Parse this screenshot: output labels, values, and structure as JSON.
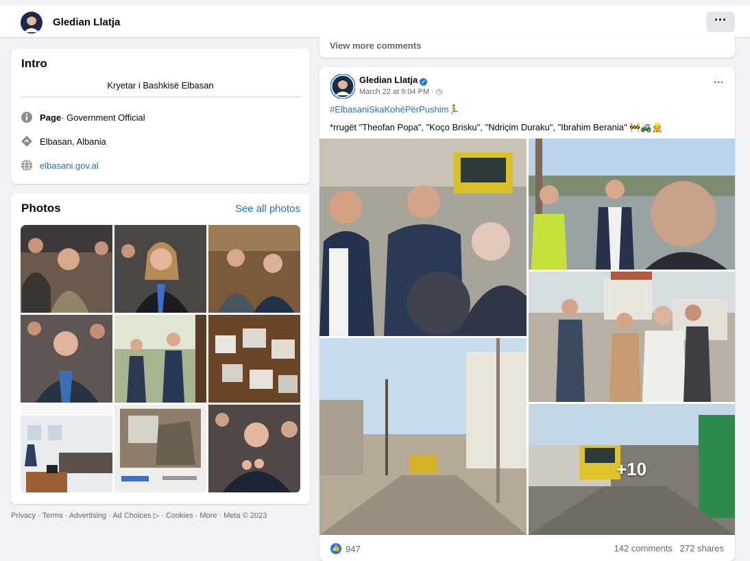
{
  "header": {
    "profile_name": "Gledian Llatja",
    "more_label": "···"
  },
  "intro": {
    "title": "Intro",
    "bio": "Kryetar i Bashkisë Elbasan",
    "page_type_bold": "Page",
    "page_type_rest": " · Government Official",
    "location": "Elbasan, Albania",
    "website": "elbasani.gov.al"
  },
  "photos": {
    "title": "Photos",
    "see_all": "See all photos"
  },
  "footer": {
    "text": "Privacy · Terms · Advertising · Ad Choices ▷ · Cookies · More · Meta © 2023"
  },
  "previous_post": {
    "view_more_comments": "View more comments"
  },
  "post": {
    "author": "Gledian Llatja",
    "verified_mark": "✓",
    "meta": "March 22 at 9:04 PM · ◷",
    "more_label": "···",
    "hashtag": "#ElbasaniSkaKohëPërPushim🏃",
    "text": "*rrugët \"Theofan Popa\", \"Koço Brisku\", \"Ndriçim Duraku\", \"Ibrahim Berania\" 🚧🚜👷",
    "extra_photos": "+10",
    "like_glyph": "👍",
    "reaction_count": "947",
    "comments": "142 comments",
    "shares": "272 shares"
  },
  "icons": {
    "info": "info-icon",
    "location": "location-icon",
    "globe": "globe-icon",
    "like": "like-icon",
    "verified": "verified-badge-icon"
  },
  "colors": {
    "link": "#216fdb",
    "background": "#f0f2f5",
    "card": "#ffffff",
    "secondary_text": "#65676b",
    "brand_blue": "#1877f2"
  }
}
